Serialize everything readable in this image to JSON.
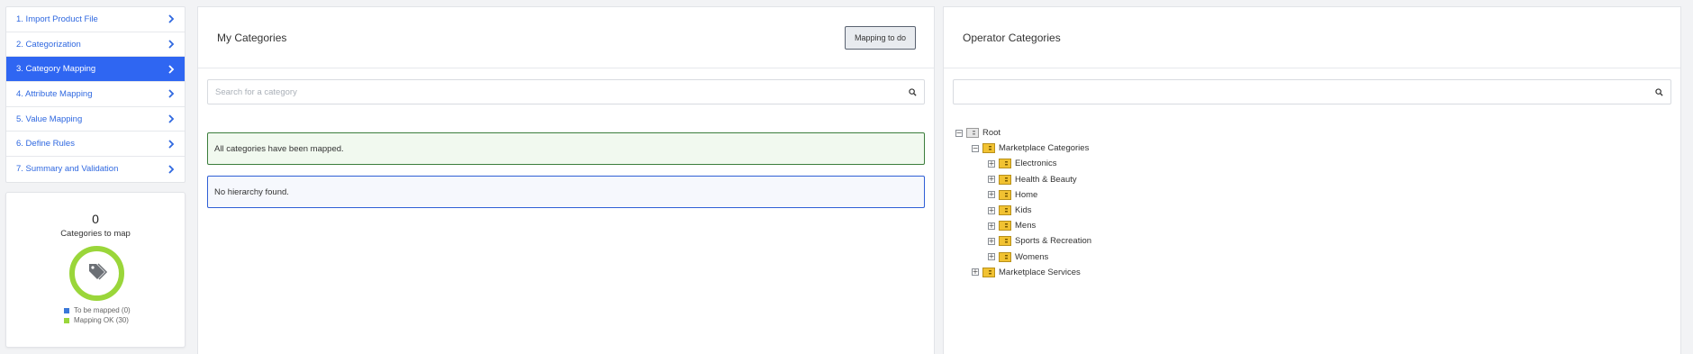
{
  "steps": [
    {
      "label": "1. Import Product File"
    },
    {
      "label": "2. Categorization"
    },
    {
      "label": "3. Category Mapping"
    },
    {
      "label": "4. Attribute Mapping"
    },
    {
      "label": "5. Value Mapping"
    },
    {
      "label": "6. Define Rules"
    },
    {
      "label": "7. Summary and Validation"
    }
  ],
  "active_step": 2,
  "stats": {
    "count": "0",
    "label": "Categories to map",
    "legend": [
      {
        "label": "To be mapped (0)",
        "color": "#3a78d8"
      },
      {
        "label": "Mapping OK (30)",
        "color": "#9ad63a"
      }
    ],
    "ring_color": "#9ad63a",
    "icon": "tag-icon"
  },
  "my_categories": {
    "title": "My Categories",
    "button": "Mapping to do",
    "search_placeholder": "Search for a category",
    "alert_success": "All categories have been mapped.",
    "alert_info": "No hierarchy found."
  },
  "operator_categories": {
    "title": "Operator Categories",
    "search_placeholder": "",
    "tree": {
      "root": "Root",
      "group": "Marketplace Categories",
      "children": [
        "Electronics",
        "Health & Beauty",
        "Home",
        "Kids",
        "Mens",
        "Sports & Recreation",
        "Womens"
      ],
      "sibling": "Marketplace Services"
    }
  },
  "colors": {
    "accent": "#2f66f2",
    "link": "#2f68e0",
    "success_border": "#3b7d3c",
    "info_border": "#2f5fd6"
  }
}
